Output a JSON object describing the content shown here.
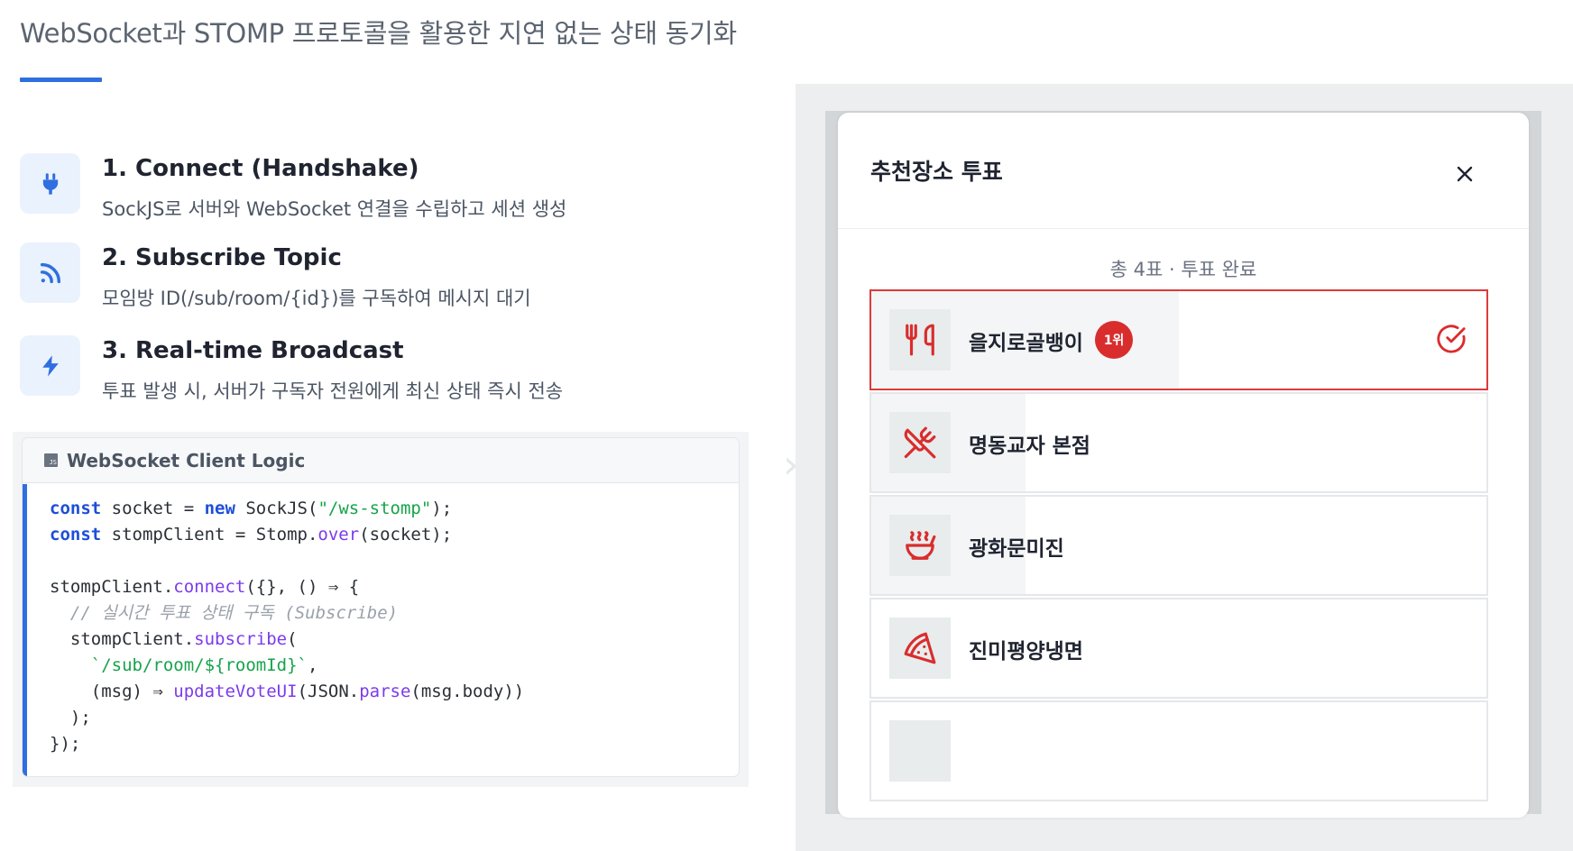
{
  "page": {
    "title": "WebSocket과 STOMP 프로토콜을 활용한 지연 없는 상태 동기화",
    "accent_color": "#2f6fe0"
  },
  "steps": [
    {
      "icon": "plug-icon",
      "title": "1. Connect (Handshake)",
      "desc": "SockJS로 서버와 WebSocket 연결을 수립하고 세션 생성"
    },
    {
      "icon": "rss-icon",
      "title": "2. Subscribe Topic",
      "desc": "모임방 ID(/sub/room/{id})를 구독하여 메시지 대기"
    },
    {
      "icon": "bolt-icon",
      "title": "3. Real-time Broadcast",
      "desc": "투표 발생 시, 서버가 구독자 전원에게 최신 상태 즉시 전송"
    }
  ],
  "code": {
    "badge": "JS",
    "title": "WebSocket Client Logic",
    "lines": [
      "const socket = new SockJS(\"/ws-stomp\");",
      "const stompClient = Stomp.over(socket);",
      "",
      "stompClient.connect({}, () ⇒ {",
      "  // 실시간 투표 상태 구독 (Subscribe)",
      "  stompClient.subscribe(",
      "    `/sub/room/${roomId}`,",
      "    (msg) ⇒ updateVoteUI(JSON.parse(msg.body))",
      "  );",
      "});"
    ]
  },
  "modal": {
    "title": "추천장소 투표",
    "summary": "총 4표 · 투표 완료",
    "options": [
      {
        "name": "을지로골뱅이",
        "icon": "utensils-icon",
        "rank": "1위",
        "share": 0.5,
        "selected": true
      },
      {
        "name": "명동교자 본점",
        "icon": "utensils-crossed-icon",
        "share": 0.25,
        "selected": false
      },
      {
        "name": "광화문미진",
        "icon": "soup-bowl-icon",
        "share": 0.25,
        "selected": false
      },
      {
        "name": "진미평양냉면",
        "icon": "pizza-icon",
        "share": 0,
        "selected": false
      }
    ],
    "selected_color": "#dc3b3b"
  }
}
